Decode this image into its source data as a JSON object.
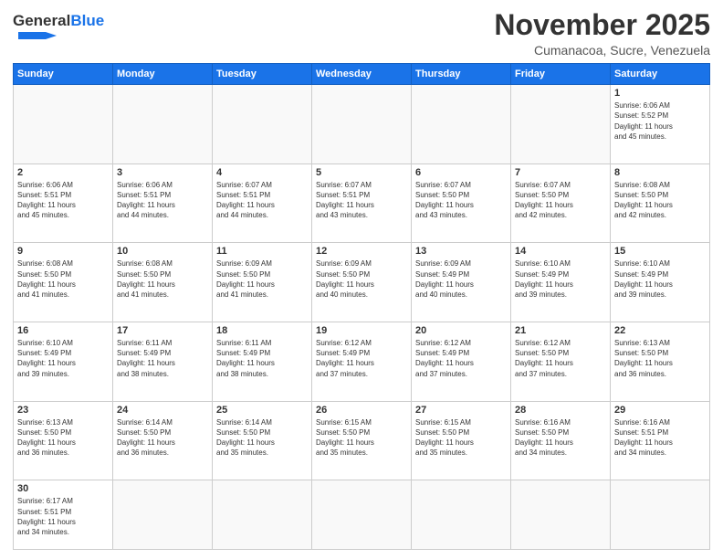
{
  "header": {
    "logo_general": "General",
    "logo_blue": "Blue",
    "month": "November 2025",
    "location": "Cumanacoa, Sucre, Venezuela"
  },
  "weekdays": [
    "Sunday",
    "Monday",
    "Tuesday",
    "Wednesday",
    "Thursday",
    "Friday",
    "Saturday"
  ],
  "weeks": [
    [
      {
        "day": "",
        "info": ""
      },
      {
        "day": "",
        "info": ""
      },
      {
        "day": "",
        "info": ""
      },
      {
        "day": "",
        "info": ""
      },
      {
        "day": "",
        "info": ""
      },
      {
        "day": "",
        "info": ""
      },
      {
        "day": "1",
        "info": "Sunrise: 6:06 AM\nSunset: 5:52 PM\nDaylight: 11 hours\nand 45 minutes."
      }
    ],
    [
      {
        "day": "2",
        "info": "Sunrise: 6:06 AM\nSunset: 5:51 PM\nDaylight: 11 hours\nand 45 minutes."
      },
      {
        "day": "3",
        "info": "Sunrise: 6:06 AM\nSunset: 5:51 PM\nDaylight: 11 hours\nand 44 minutes."
      },
      {
        "day": "4",
        "info": "Sunrise: 6:07 AM\nSunset: 5:51 PM\nDaylight: 11 hours\nand 44 minutes."
      },
      {
        "day": "5",
        "info": "Sunrise: 6:07 AM\nSunset: 5:51 PM\nDaylight: 11 hours\nand 43 minutes."
      },
      {
        "day": "6",
        "info": "Sunrise: 6:07 AM\nSunset: 5:50 PM\nDaylight: 11 hours\nand 43 minutes."
      },
      {
        "day": "7",
        "info": "Sunrise: 6:07 AM\nSunset: 5:50 PM\nDaylight: 11 hours\nand 42 minutes."
      },
      {
        "day": "8",
        "info": "Sunrise: 6:08 AM\nSunset: 5:50 PM\nDaylight: 11 hours\nand 42 minutes."
      }
    ],
    [
      {
        "day": "9",
        "info": "Sunrise: 6:08 AM\nSunset: 5:50 PM\nDaylight: 11 hours\nand 41 minutes."
      },
      {
        "day": "10",
        "info": "Sunrise: 6:08 AM\nSunset: 5:50 PM\nDaylight: 11 hours\nand 41 minutes."
      },
      {
        "day": "11",
        "info": "Sunrise: 6:09 AM\nSunset: 5:50 PM\nDaylight: 11 hours\nand 41 minutes."
      },
      {
        "day": "12",
        "info": "Sunrise: 6:09 AM\nSunset: 5:50 PM\nDaylight: 11 hours\nand 40 minutes."
      },
      {
        "day": "13",
        "info": "Sunrise: 6:09 AM\nSunset: 5:49 PM\nDaylight: 11 hours\nand 40 minutes."
      },
      {
        "day": "14",
        "info": "Sunrise: 6:10 AM\nSunset: 5:49 PM\nDaylight: 11 hours\nand 39 minutes."
      },
      {
        "day": "15",
        "info": "Sunrise: 6:10 AM\nSunset: 5:49 PM\nDaylight: 11 hours\nand 39 minutes."
      }
    ],
    [
      {
        "day": "16",
        "info": "Sunrise: 6:10 AM\nSunset: 5:49 PM\nDaylight: 11 hours\nand 39 minutes."
      },
      {
        "day": "17",
        "info": "Sunrise: 6:11 AM\nSunset: 5:49 PM\nDaylight: 11 hours\nand 38 minutes."
      },
      {
        "day": "18",
        "info": "Sunrise: 6:11 AM\nSunset: 5:49 PM\nDaylight: 11 hours\nand 38 minutes."
      },
      {
        "day": "19",
        "info": "Sunrise: 6:12 AM\nSunset: 5:49 PM\nDaylight: 11 hours\nand 37 minutes."
      },
      {
        "day": "20",
        "info": "Sunrise: 6:12 AM\nSunset: 5:49 PM\nDaylight: 11 hours\nand 37 minutes."
      },
      {
        "day": "21",
        "info": "Sunrise: 6:12 AM\nSunset: 5:50 PM\nDaylight: 11 hours\nand 37 minutes."
      },
      {
        "day": "22",
        "info": "Sunrise: 6:13 AM\nSunset: 5:50 PM\nDaylight: 11 hours\nand 36 minutes."
      }
    ],
    [
      {
        "day": "23",
        "info": "Sunrise: 6:13 AM\nSunset: 5:50 PM\nDaylight: 11 hours\nand 36 minutes."
      },
      {
        "day": "24",
        "info": "Sunrise: 6:14 AM\nSunset: 5:50 PM\nDaylight: 11 hours\nand 36 minutes."
      },
      {
        "day": "25",
        "info": "Sunrise: 6:14 AM\nSunset: 5:50 PM\nDaylight: 11 hours\nand 35 minutes."
      },
      {
        "day": "26",
        "info": "Sunrise: 6:15 AM\nSunset: 5:50 PM\nDaylight: 11 hours\nand 35 minutes."
      },
      {
        "day": "27",
        "info": "Sunrise: 6:15 AM\nSunset: 5:50 PM\nDaylight: 11 hours\nand 35 minutes."
      },
      {
        "day": "28",
        "info": "Sunrise: 6:16 AM\nSunset: 5:50 PM\nDaylight: 11 hours\nand 34 minutes."
      },
      {
        "day": "29",
        "info": "Sunrise: 6:16 AM\nSunset: 5:51 PM\nDaylight: 11 hours\nand 34 minutes."
      }
    ],
    [
      {
        "day": "30",
        "info": "Sunrise: 6:17 AM\nSunset: 5:51 PM\nDaylight: 11 hours\nand 34 minutes."
      },
      {
        "day": "",
        "info": ""
      },
      {
        "day": "",
        "info": ""
      },
      {
        "day": "",
        "info": ""
      },
      {
        "day": "",
        "info": ""
      },
      {
        "day": "",
        "info": ""
      },
      {
        "day": "",
        "info": ""
      }
    ]
  ]
}
